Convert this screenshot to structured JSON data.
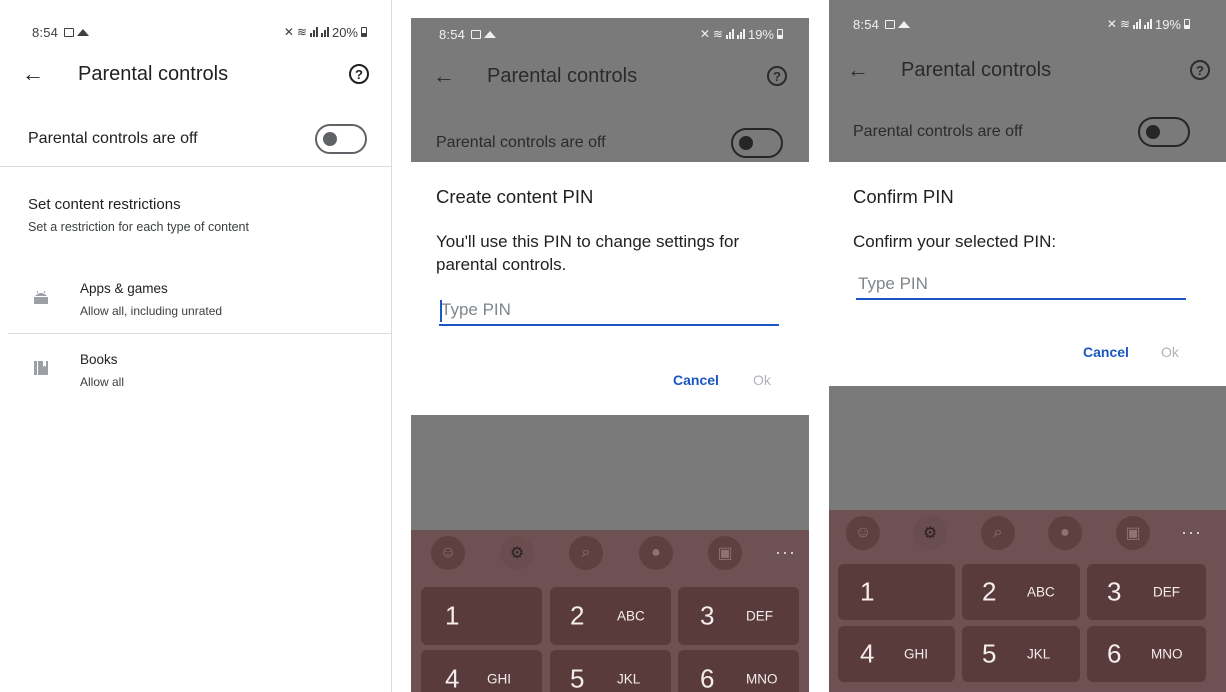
{
  "panels": [
    {
      "status": {
        "time": "8:54",
        "battery": "20%"
      },
      "appbar": {
        "title": "Parental controls"
      },
      "toggle": {
        "label": "Parental controls are off",
        "state": "off"
      },
      "section": {
        "title": "Set content restrictions",
        "subtitle": "Set a restriction for each type of content"
      },
      "items": [
        {
          "title": "Apps & games",
          "subtitle": "Allow all, including unrated",
          "icon": "android-icon"
        },
        {
          "title": "Books",
          "subtitle": "Allow all",
          "icon": "book-icon"
        }
      ]
    },
    {
      "status": {
        "time": "8:54",
        "battery": "19%"
      },
      "appbar": {
        "title": "Parental controls"
      },
      "toggle": {
        "label": "Parental controls are off"
      },
      "dialog": {
        "title": "Create content PIN",
        "body": "You'll use this PIN to change settings for parental controls.",
        "placeholder": "Type PIN",
        "cancel": "Cancel",
        "ok": "Ok"
      },
      "keyboard": {
        "keys": [
          {
            "num": "1",
            "letters": ""
          },
          {
            "num": "2",
            "letters": "ABC"
          },
          {
            "num": "3",
            "letters": "DEF"
          },
          {
            "num": "4",
            "letters": "GHI"
          },
          {
            "num": "5",
            "letters": "JKL"
          },
          {
            "num": "6",
            "letters": "MNO"
          }
        ],
        "more": "···"
      }
    },
    {
      "status": {
        "time": "8:54",
        "battery": "19%"
      },
      "appbar": {
        "title": "Parental controls"
      },
      "toggle": {
        "label": "Parental controls are off"
      },
      "dialog": {
        "title": "Confirm PIN",
        "body": "Confirm your selected PIN:",
        "placeholder": "Type PIN",
        "cancel": "Cancel",
        "ok": "Ok"
      },
      "keyboard": {
        "keys": [
          {
            "num": "1",
            "letters": ""
          },
          {
            "num": "2",
            "letters": "ABC"
          },
          {
            "num": "3",
            "letters": "DEF"
          },
          {
            "num": "4",
            "letters": "GHI"
          },
          {
            "num": "5",
            "letters": "JKL"
          },
          {
            "num": "6",
            "letters": "MNO"
          }
        ],
        "more": "···"
      }
    }
  ],
  "colors": {
    "accent": "#1a56c4",
    "keyboard_bg": "#6e5152",
    "key_bg": "#5a3b3c",
    "scrim": "#7a7a7a"
  }
}
